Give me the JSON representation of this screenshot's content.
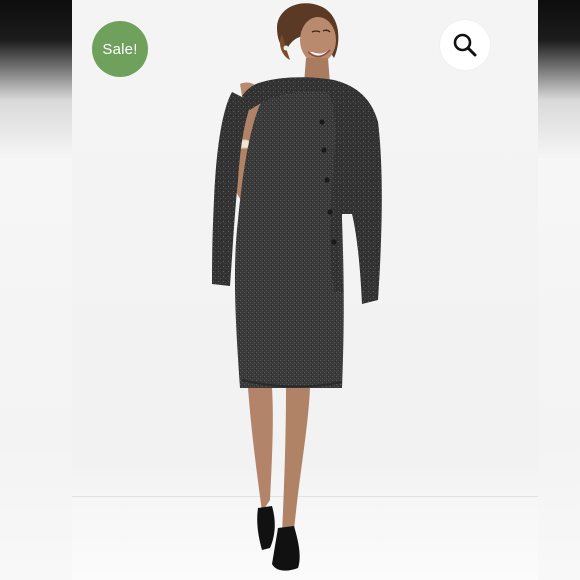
{
  "badge": {
    "label": "Sale!",
    "color": "#6fa05c"
  },
  "zoom_button": {
    "icon": "magnifier-icon"
  },
  "photo": {
    "subject": "model-product-photo"
  }
}
